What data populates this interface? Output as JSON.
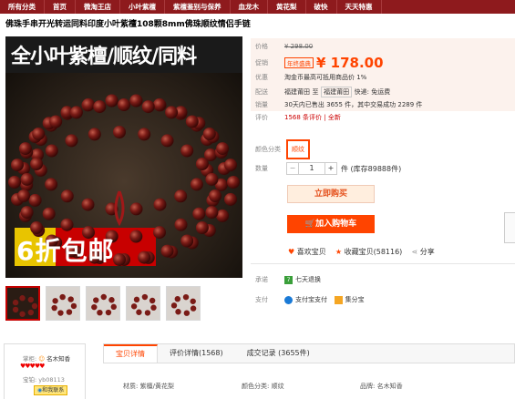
{
  "nav": [
    "所有分类",
    "首页",
    "微淘王店",
    "小叶紫檀",
    "紫檀鉴别与保养",
    "血龙木",
    "黄花梨",
    "破快",
    "天天特惠"
  ],
  "title": "佛珠手串开光转运同料印度小叶紫檀108颗8mm佛珠顺纹情侣手链",
  "banner": {
    "top": "全小叶紫檀/顺纹/同料",
    "bottom": "6折包邮"
  },
  "labels": {
    "price": "价格",
    "promo": "促销",
    "perk": "优惠",
    "ship": "配送",
    "sales": "销量",
    "rate": "评价",
    "color": "颜色分类",
    "qty": "数量",
    "promise": "承诺",
    "pay": "支付"
  },
  "price": {
    "orig": "¥ 298.00",
    "tag": "年终盛典",
    "now": "¥ 178.00"
  },
  "perk": "淘金币最高可抵用商品价 1%",
  "ship": {
    "from": "福建莆田",
    "to": "至",
    "dest": "福建莆田",
    "method": "快递: 免运费"
  },
  "sales": "30天内已售出 3655 件，其中交易成功 2289 件",
  "rate": "1568 条评价 | 全新",
  "color_option": "顺纹",
  "qty": {
    "minus": "−",
    "value": "1",
    "plus": "+",
    "stock": "件 (库存89888件)"
  },
  "buttons": {
    "buy": "立即购买",
    "cart": "加入购物车"
  },
  "social": {
    "like": "喜欢宝贝",
    "fav": "收藏宝贝(58116)",
    "share": "分享"
  },
  "promise": "七天退换",
  "pay": {
    "alipay": "支付宝支付",
    "jifen": "集分宝"
  },
  "shop": {
    "label": "掌柜:",
    "name": "名木知香",
    "rank": "宝铂: yb08113",
    "contact": "和我联系"
  },
  "tabs": [
    "宝贝详情",
    "评价详情(1568)",
    "成交记录 (3655件)"
  ],
  "attrs": [
    "材质: 紫檀/黄花梨",
    "颜色分类: 顺纹",
    "品牌: 名木知香"
  ],
  "colors": {
    "brand": "#8e1a1d",
    "orange": "#ff4400"
  }
}
